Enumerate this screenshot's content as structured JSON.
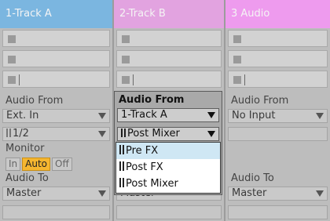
{
  "tracks": [
    {
      "name": "1-Track A",
      "color": "#7bb6e0"
    },
    {
      "name": "2-Track B",
      "color": "#e2a3e0"
    },
    {
      "name": "3 Audio",
      "color": "#ee9bee"
    }
  ],
  "track1": {
    "audio_from_label": "Audio From",
    "audio_from_value": "Ext. In",
    "channel_value": "1/2",
    "monitor_label": "Monitor",
    "monitor_options": [
      "In",
      "Auto",
      "Off"
    ],
    "monitor_selected": "Auto",
    "audio_to_label": "Audio To",
    "audio_to_value": "Master"
  },
  "track2": {
    "audio_from_label": "Audio From",
    "audio_from_value": "1-Track A",
    "tap_value": "Post Mixer",
    "dropdown_options": [
      "Pre FX",
      "Post FX",
      "Post Mixer"
    ],
    "dropdown_highlighted": "Pre FX",
    "audio_to_value": "Master"
  },
  "track3": {
    "audio_from_label": "Audio From",
    "audio_from_value": "No Input",
    "audio_to_label": "Audio To",
    "audio_to_value": "Master"
  }
}
